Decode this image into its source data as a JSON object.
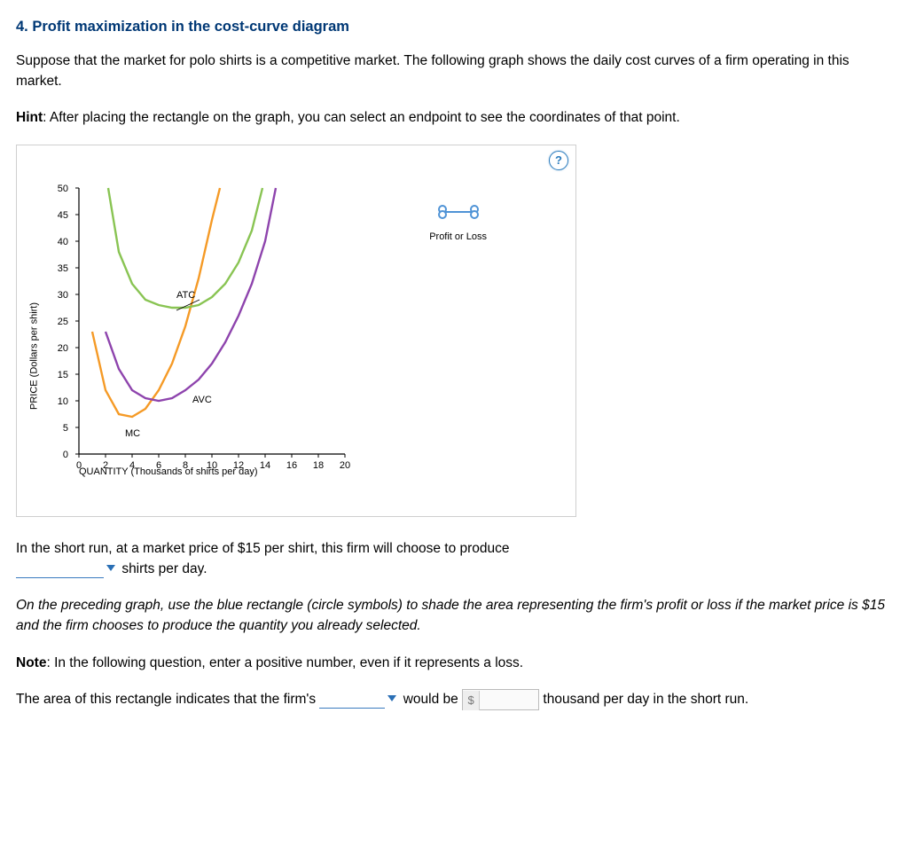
{
  "title": "4. Profit maximization in the cost-curve diagram",
  "intro": "Suppose that the market for polo shirts is a competitive market. The following graph shows the daily cost curves of a firm operating in this market.",
  "hint_label": "Hint",
  "hint": ": After placing the rectangle on the graph, you can select an endpoint to see the coordinates of that point.",
  "graph": {
    "help_icon": "?",
    "ylabel": "PRICE (Dollars per shirt)",
    "xlabel": "QUANTITY (Thousands of shirts per day)",
    "legend_label": "Profit or Loss",
    "curve_labels": {
      "mc": "MC",
      "avc": "AVC",
      "atc": "ATC"
    }
  },
  "chart_data": {
    "type": "line",
    "xlim": [
      0,
      20
    ],
    "ylim": [
      0,
      50
    ],
    "x_ticks": [
      0,
      2,
      4,
      6,
      8,
      10,
      12,
      14,
      16,
      18,
      20
    ],
    "y_ticks": [
      0,
      5,
      10,
      15,
      20,
      25,
      30,
      35,
      40,
      45,
      50
    ],
    "series": [
      {
        "name": "MC",
        "color": "#f59a26",
        "points": [
          [
            1,
            23
          ],
          [
            2,
            12
          ],
          [
            3,
            7.5
          ],
          [
            4,
            7
          ],
          [
            5,
            8.5
          ],
          [
            6,
            12
          ],
          [
            7,
            17
          ],
          [
            8,
            24
          ],
          [
            9,
            33
          ],
          [
            10,
            44
          ],
          [
            10.6,
            50
          ]
        ]
      },
      {
        "name": "ATC",
        "color": "#89c453",
        "points": [
          [
            2.2,
            50
          ],
          [
            3,
            38
          ],
          [
            4,
            32
          ],
          [
            5,
            29
          ],
          [
            6,
            28
          ],
          [
            7,
            27.5
          ],
          [
            8,
            27.5
          ],
          [
            9,
            28
          ],
          [
            10,
            29.5
          ],
          [
            11,
            32
          ],
          [
            12,
            36
          ],
          [
            13,
            42
          ],
          [
            13.8,
            50
          ]
        ]
      },
      {
        "name": "AVC",
        "color": "#8e44ad",
        "points": [
          [
            2,
            23
          ],
          [
            3,
            16
          ],
          [
            4,
            12
          ],
          [
            5,
            10.5
          ],
          [
            6,
            10
          ],
          [
            7,
            10.5
          ],
          [
            8,
            12
          ],
          [
            9,
            14
          ],
          [
            10,
            17
          ],
          [
            11,
            21
          ],
          [
            12,
            26
          ],
          [
            13,
            32
          ],
          [
            14,
            40
          ],
          [
            14.8,
            50
          ]
        ]
      }
    ],
    "title": "",
    "xlabel": "QUANTITY (Thousands of shirts per day)",
    "ylabel": "PRICE (Dollars per shirt)"
  },
  "q1": {
    "pre": "In the short run, at a market price of $15 per shirt, this firm will choose to produce ",
    "post": " shirts per day."
  },
  "instr": "On the preceding graph, use the blue rectangle (circle symbols) to shade the area representing the firm's profit or loss if the market price is $15 and the firm chooses to produce the quantity you already selected.",
  "note_label": "Note",
  "note": ": In the following question, enter a positive number, even if it represents a loss.",
  "q2": {
    "pre": "The area of this rectangle indicates that the firm's ",
    "mid": " would be ",
    "post": " thousand per day in the short run.",
    "sym": "$"
  }
}
